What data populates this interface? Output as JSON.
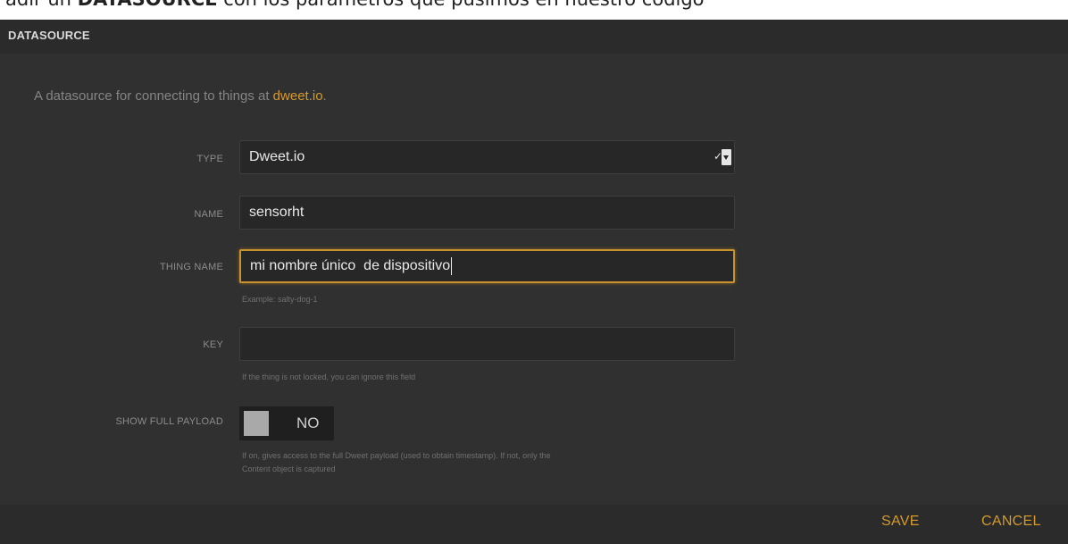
{
  "page_text": {
    "prefix": "adir un ",
    "bold": "DATASOURCE",
    "suffix": " con los parámetros que pusimos en nuestro código"
  },
  "dialog": {
    "title": "DATASOURCE",
    "description_text": "A datasource for connecting to things at ",
    "description_link": "dweet.io",
    "description_end": "."
  },
  "form": {
    "type": {
      "label": "TYPE",
      "value": "Dweet.io"
    },
    "name": {
      "label": "NAME",
      "value": "sensorht"
    },
    "thing_name": {
      "label": "THING NAME",
      "value": "mi nombre único  de dispositivo",
      "hint": "Example: salty-dog-1"
    },
    "key": {
      "label": "KEY",
      "value": "",
      "hint": "If the thing is not locked, you can ignore this field"
    },
    "show_full_payload": {
      "label": "SHOW FULL PAYLOAD",
      "value": "NO",
      "hint_line1": "If on, gives access to the full Dweet payload (used to obtain timestamp). If not, only the",
      "hint_line2": "Content object is captured"
    }
  },
  "actions": {
    "save": "SAVE",
    "cancel": "CANCEL"
  },
  "colors": {
    "accent": "#d59a2a",
    "background": "#2a2a2a"
  },
  "icons": {
    "select": "dropdown-arrow-icon",
    "toggle": "toggle-knob-icon"
  }
}
